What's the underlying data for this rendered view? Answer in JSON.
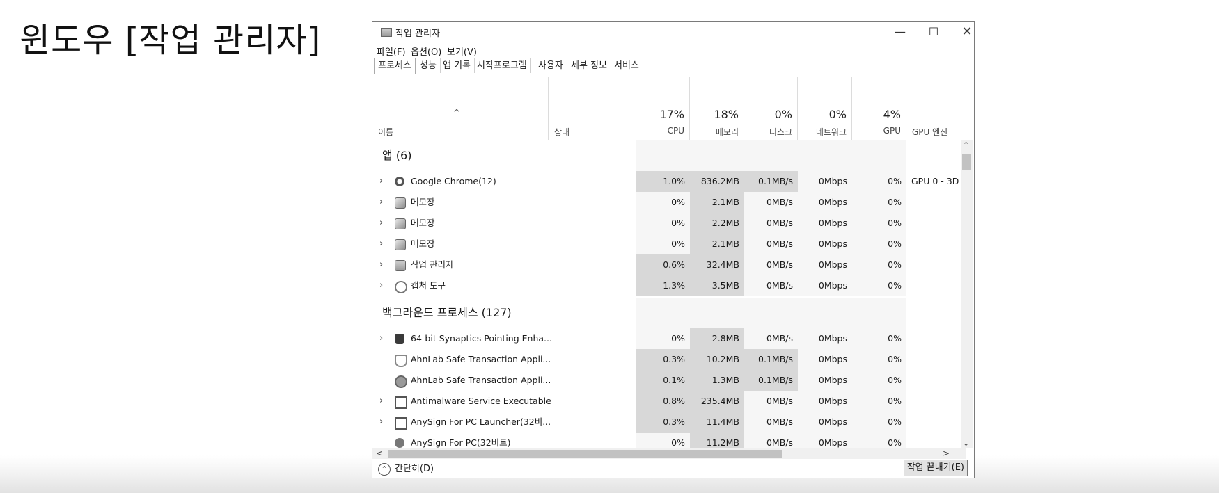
{
  "slide": {
    "title": "윈도우 [작업 관리자]"
  },
  "window": {
    "title": "작업 관리자",
    "minimize": "—",
    "maximize": "☐",
    "close": "✕"
  },
  "menu": [
    "파일(F)",
    "옵션(O)",
    "보기(V)"
  ],
  "tabs": [
    "프로세스",
    "성능",
    "앱 기록",
    "시작프로그램",
    "사용자",
    "세부 정보",
    "서비스"
  ],
  "header": {
    "sort_arrow": "^",
    "name": "이름",
    "status": "상태",
    "cpu": {
      "pct": "17%",
      "label": "CPU"
    },
    "memory": {
      "pct": "18%",
      "label": "메모리"
    },
    "disk": {
      "pct": "0%",
      "label": "디스크"
    },
    "network": {
      "pct": "0%",
      "label": "네트워크"
    },
    "gpu": {
      "pct": "4%",
      "label": "GPU"
    },
    "gpu_engine": {
      "label": "GPU 엔진"
    }
  },
  "groups": [
    {
      "title": "앱 (6)",
      "rows": [
        {
          "name": "Google Chrome(12)",
          "icon": "chrome-icon",
          "expand": true,
          "cpu": "1.0%",
          "mem": "836.2MB",
          "disk": "0.1MB/s",
          "net": "0Mbps",
          "gpu": "0%",
          "eng": "GPU 0 - 3D"
        },
        {
          "name": "메모장",
          "icon": "notepad-icon",
          "expand": true,
          "cpu": "0%",
          "mem": "2.1MB",
          "disk": "0MB/s",
          "net": "0Mbps",
          "gpu": "0%",
          "eng": ""
        },
        {
          "name": "메모장",
          "icon": "notepad-icon",
          "expand": true,
          "cpu": "0%",
          "mem": "2.2MB",
          "disk": "0MB/s",
          "net": "0Mbps",
          "gpu": "0%",
          "eng": ""
        },
        {
          "name": "메모장",
          "icon": "notepad-icon",
          "expand": true,
          "cpu": "0%",
          "mem": "2.1MB",
          "disk": "0MB/s",
          "net": "0Mbps",
          "gpu": "0%",
          "eng": ""
        },
        {
          "name": "작업 관리자",
          "icon": "task-manager-icon",
          "expand": true,
          "cpu": "0.6%",
          "mem": "32.4MB",
          "disk": "0MB/s",
          "net": "0Mbps",
          "gpu": "0%",
          "eng": ""
        },
        {
          "name": "캡처 도구",
          "icon": "snipping-tool-icon",
          "expand": true,
          "cpu": "1.3%",
          "mem": "3.5MB",
          "disk": "0MB/s",
          "net": "0Mbps",
          "gpu": "0%",
          "eng": ""
        }
      ]
    },
    {
      "title": "백그라운드 프로세스 (127)",
      "rows": [
        {
          "name": "64-bit Synaptics Pointing Enha...",
          "icon": "synaptics-icon",
          "expand": true,
          "cpu": "0%",
          "mem": "2.8MB",
          "disk": "0MB/s",
          "net": "0Mbps",
          "gpu": "0%",
          "eng": ""
        },
        {
          "name": "AhnLab Safe Transaction Appli...",
          "icon": "shield-icon",
          "expand": false,
          "cpu": "0.3%",
          "mem": "10.2MB",
          "disk": "0.1MB/s",
          "net": "0Mbps",
          "gpu": "0%",
          "eng": ""
        },
        {
          "name": "AhnLab Safe Transaction Appli...",
          "icon": "gear-shield-icon",
          "expand": false,
          "cpu": "0.1%",
          "mem": "1.3MB",
          "disk": "0.1MB/s",
          "net": "0Mbps",
          "gpu": "0%",
          "eng": ""
        },
        {
          "name": "Antimalware Service Executable",
          "icon": "service-icon",
          "expand": true,
          "cpu": "0.8%",
          "mem": "235.4MB",
          "disk": "0MB/s",
          "net": "0Mbps",
          "gpu": "0%",
          "eng": ""
        },
        {
          "name": "AnySign For PC Launcher(32비...",
          "icon": "service-icon",
          "expand": true,
          "cpu": "0.3%",
          "mem": "11.4MB",
          "disk": "0MB/s",
          "net": "0Mbps",
          "gpu": "0%",
          "eng": ""
        },
        {
          "name": "AnySign For PC(32비트)",
          "icon": "anysign-icon",
          "expand": false,
          "cpu": "0%",
          "mem": "11.2MB",
          "disk": "0MB/s",
          "net": "0Mbps",
          "gpu": "0%",
          "eng": ""
        }
      ]
    }
  ],
  "colors": {
    "heat_high": "#d8d8d8",
    "heat_low": "#ececec",
    "heat_none": "#f6f6f6"
  },
  "footer": {
    "fewer_details": "간단히(D)",
    "end_task": "작업 끝내기(E)"
  }
}
